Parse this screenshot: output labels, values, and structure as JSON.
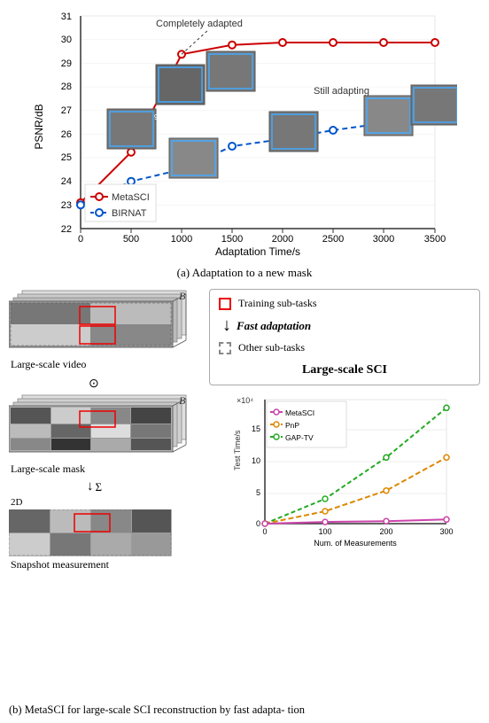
{
  "chart_top": {
    "title_annotation_completely": "Completely adapted",
    "title_annotation_still": "Still adapting",
    "y_axis_label": "PSNR/dB",
    "x_axis_label": "Adaptation Time/s",
    "y_ticks": [
      "22",
      "23",
      "24",
      "25",
      "26",
      "27",
      "28",
      "29",
      "30",
      "31"
    ],
    "x_ticks": [
      "0",
      "500",
      "1000",
      "1500",
      "2000",
      "2500",
      "3000",
      "3500"
    ],
    "legend": {
      "metasci_label": "MetaSCI",
      "birnat_label": "BIRNAT"
    },
    "caption": "(a) Adaptation to a new mask"
  },
  "adaptation_box": {
    "training_label": "Training sub-tasks",
    "arrow_label": "Fast adaptation",
    "other_label": "Other sub-tasks",
    "result_label": "Large-scale SCI"
  },
  "time_chart": {
    "y_axis_label": "Test Time/s",
    "x_axis_label": "Num. of Measurements",
    "y_ticks_power": "×10⁴",
    "y_ticks": [
      "0",
      "5",
      "10",
      "15"
    ],
    "x_ticks": [
      "0",
      "100",
      "200",
      "300"
    ],
    "legend": {
      "metasci": "MetaSCI",
      "pnp": "PnP",
      "gap_tv": "GAP-TV"
    }
  },
  "left_panel": {
    "video_label": "Large-scale video",
    "mask_label": "Large-scale mask",
    "snapshot_label": "Snapshot measurement",
    "b_label": "B",
    "odot": "⊙",
    "sum_arrow": "↓",
    "sum_symbol": "Σ"
  },
  "bottom_caption": "(b) MetaSCI for large-scale SCI reconstruction by fast adapta-\ntion"
}
